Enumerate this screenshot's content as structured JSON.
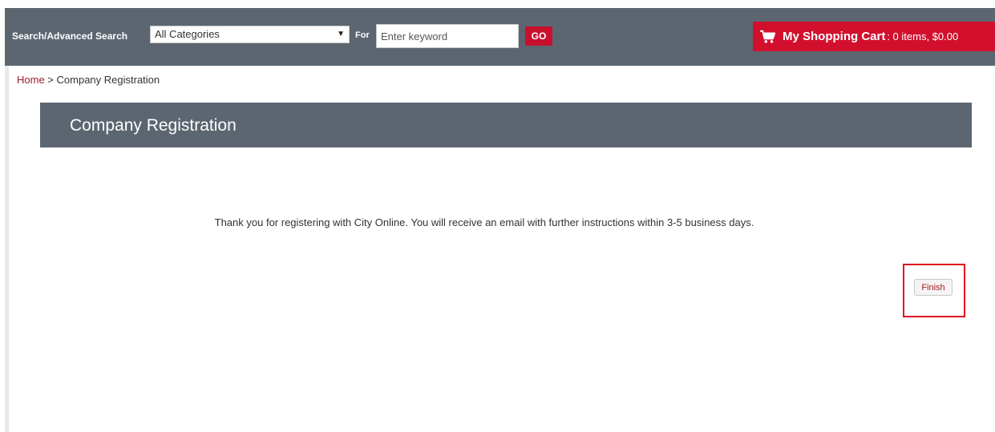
{
  "header": {
    "search_label": "Search/Advanced Search",
    "category_selected": "All Categories",
    "for_label": "For",
    "keyword_placeholder": "Enter keyword",
    "go_label": "GO",
    "cart": {
      "title": "My Shopping Cart",
      "summary": ": 0 items, $0.00",
      "icon": "shopping-cart-icon"
    }
  },
  "breadcrumb": {
    "home": "Home",
    "separator": " > ",
    "current": "Company Registration"
  },
  "panel": {
    "title": "Company Registration"
  },
  "message": "Thank you for registering with City Online. You will receive an email with further instructions within 3-5 business days.",
  "actions": {
    "finish_label": "Finish"
  },
  "colors": {
    "header_bg": "#5b6670",
    "accent_red": "#d2102e",
    "link": "#a01c24",
    "highlight": "#e0121e"
  }
}
